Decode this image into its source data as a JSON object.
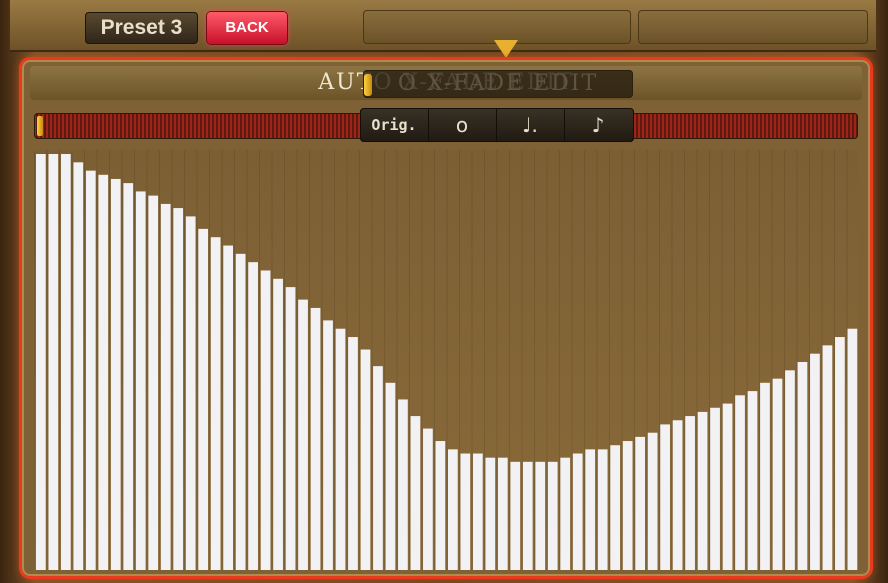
{
  "header": {
    "preset_label": "Preset 3",
    "back_label": "BACK"
  },
  "panel": {
    "title": "AUTO X-FADE EDIT",
    "title_visible_left": "AU",
    "title_visible_right": "O X-FADE EDIT"
  },
  "note_buttons": {
    "orig_label": "Orig.",
    "whole_glyph": "𝅝",
    "dotted_quarter_glyph": "♩.",
    "eighth_glyph": "♪"
  },
  "colors": {
    "accent_red": "#e83a1c",
    "bar_fill": "#f2f2f4",
    "knob_gold": "#e8b030"
  },
  "chart_data": {
    "type": "bar",
    "ylim": [
      0,
      1
    ],
    "values": [
      1.0,
      1.0,
      1.0,
      0.98,
      0.96,
      0.95,
      0.94,
      0.93,
      0.91,
      0.9,
      0.88,
      0.87,
      0.85,
      0.82,
      0.8,
      0.78,
      0.76,
      0.74,
      0.72,
      0.7,
      0.68,
      0.65,
      0.63,
      0.6,
      0.58,
      0.56,
      0.53,
      0.49,
      0.45,
      0.41,
      0.37,
      0.34,
      0.31,
      0.29,
      0.28,
      0.28,
      0.27,
      0.27,
      0.26,
      0.26,
      0.26,
      0.26,
      0.27,
      0.28,
      0.29,
      0.29,
      0.3,
      0.31,
      0.32,
      0.33,
      0.35,
      0.36,
      0.37,
      0.38,
      0.39,
      0.4,
      0.42,
      0.43,
      0.45,
      0.46,
      0.48,
      0.5,
      0.52,
      0.54,
      0.56,
      0.58
    ]
  }
}
